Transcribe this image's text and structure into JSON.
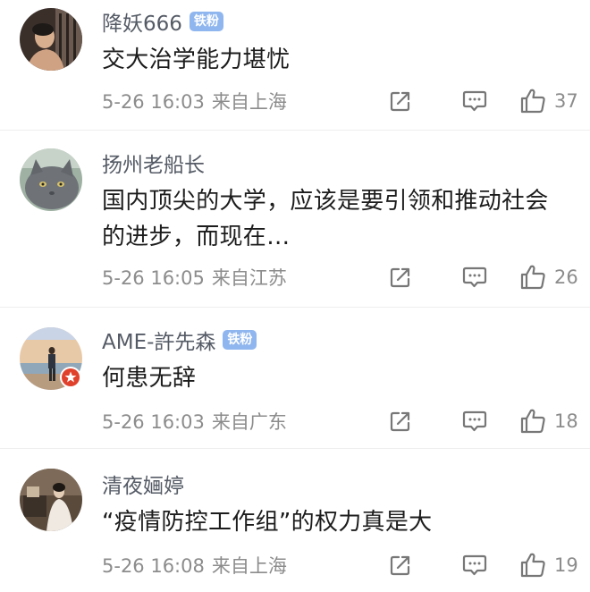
{
  "comments": [
    {
      "username": "降妖666",
      "badge": "铁粉",
      "content": "交大治学能力堪忧",
      "time": "5-26 16:03",
      "location": "来自上海",
      "likes": "37",
      "avatar_icon": "person-photo-avatar"
    },
    {
      "username": "扬州老船长",
      "content_line1": "国内顶尖的大学，应该是要引领和推动社会",
      "content_line2": "的进步，而现在…",
      "time": "5-26 16:05",
      "location": "来自江苏",
      "likes": "26",
      "avatar_icon": "gray-cat-avatar"
    },
    {
      "username": "AME-許先森",
      "badge": "铁粉",
      "content": "何患无辞",
      "time": "5-26 16:03",
      "location": "来自广东",
      "likes": "18",
      "avatar_icon": "beach-sunset-avatar",
      "verified_icon": "verified-star-icon"
    },
    {
      "username": "清夜婳婷",
      "content": "“疫情防控工作组”的权力真是大",
      "time": "5-26 16:08",
      "location": "来自上海",
      "likes": "19",
      "avatar_icon": "portrait-photo-avatar"
    }
  ],
  "icons": {
    "share": "share-icon",
    "comment": "comment-icon",
    "like": "thumbs-up-icon"
  },
  "colors": {
    "badge": "#8fb6ee",
    "username": "#555b66",
    "meta": "#8c8c8c",
    "verified": "#e0412c"
  }
}
